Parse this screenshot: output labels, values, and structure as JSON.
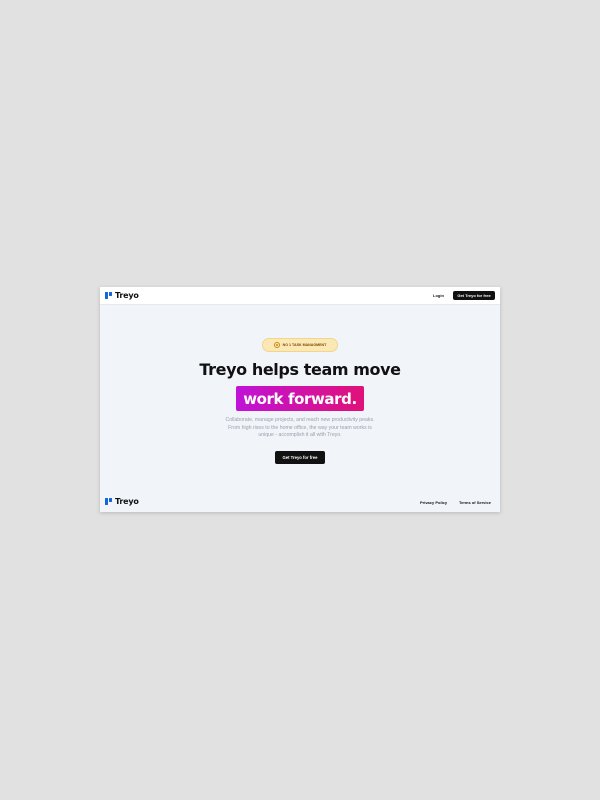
{
  "nav": {
    "brand": "Treyo",
    "login_label": "Login",
    "cta_label": "Get Treyo for free"
  },
  "hero": {
    "badge_label": "NO 1 TASK MANAGMENT",
    "headline": "Treyo helps team move",
    "highlight": "work forward.",
    "description_lines": [
      "Collaborate, manage projects, and reach new productivity peaks.",
      "From high rises to the home office, the way your team works is",
      "unique - accomplish it all with Treyo."
    ],
    "cta_label": "Get Treyo for free"
  },
  "footer": {
    "brand": "Treyo",
    "privacy_label": "Privacy Policy",
    "terms_label": "Terms of Service"
  },
  "colors": {
    "accent_blue": "#1565d8",
    "highlight_start": "#c013d8",
    "highlight_end": "#e01178",
    "badge_bg": "#fbe8b4",
    "button_dark": "#111111",
    "page_bg": "#f1f4f9"
  },
  "icons": {
    "brand_logo": "treyo-logo-icon",
    "badge": "lightbulb-icon"
  }
}
